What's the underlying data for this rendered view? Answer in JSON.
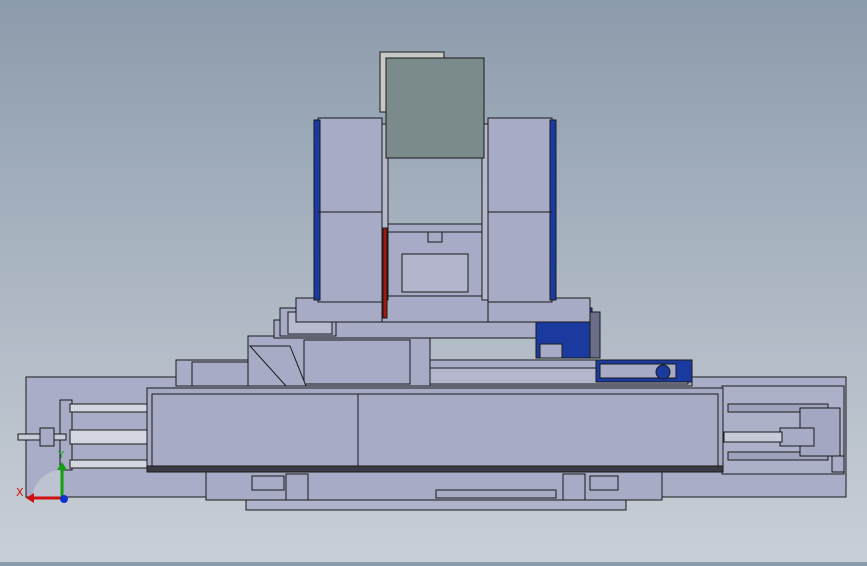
{
  "viewport": {
    "background_top": "#8c9bab",
    "background_bottom": "#c9cfd6"
  },
  "model": {
    "body_color": "#a7abc6",
    "edge_color": "#1a1a1a",
    "accent_blue": "#1a3aa0",
    "accent_red": "#a01a10",
    "block_gray": "#7b8a8a"
  },
  "triad": {
    "x_label": "X",
    "y_label": "Y",
    "x_color": "#d01010",
    "y_color": "#10a010",
    "z_color": "#1030d0"
  }
}
